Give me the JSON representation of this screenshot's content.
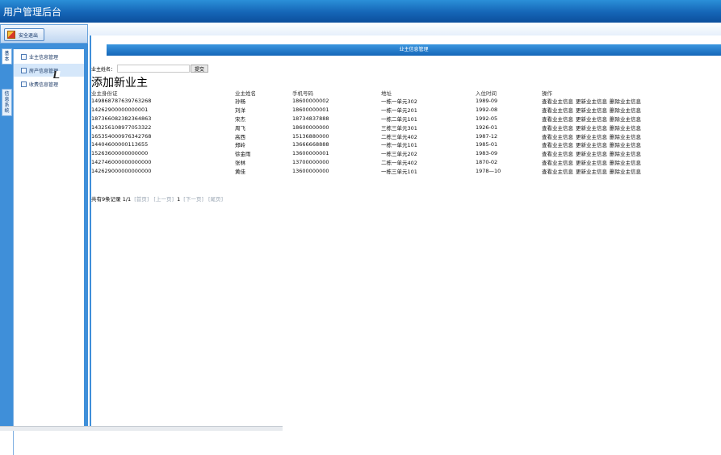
{
  "app": {
    "title": "用户管理后台"
  },
  "sidebar": {
    "exit_label": "安全退出",
    "vtabs": [
      {
        "label": "基本"
      },
      {
        "label": "信息系统"
      }
    ],
    "items": [
      {
        "label": "业主信息管理"
      },
      {
        "label": "房产信息管理"
      },
      {
        "label": "收费信息管理"
      }
    ]
  },
  "main": {
    "banner": "业主信息管理",
    "search_label": "业主姓名：",
    "search_value": "",
    "search_button": "提交",
    "add_title": "添加新业主",
    "columns": [
      "业主身份证",
      "业主姓名",
      "手机号码",
      "地址",
      "入住时间",
      "操作"
    ],
    "rows": [
      [
        "149868787639763268",
        "孙畅",
        "18600000002",
        "一栋一单元302",
        "1989-09"
      ],
      [
        "14262900000000001",
        "刘洋",
        "18600000001",
        "一栋一单元201",
        "1992-08"
      ],
      [
        "187366082382364863",
        "宋杰",
        "18734837888",
        "一栋二单元101",
        "1992-05"
      ],
      [
        "143256108977053322",
        "周飞",
        "18600000000",
        "三栋三单元301",
        "1926-01"
      ],
      [
        "165354000976342768",
        "高西",
        "15136880000",
        "二栋三单元402",
        "1987-12"
      ],
      [
        "14404600000113655",
        "郑岭",
        "13666668888",
        "一栋一单元101",
        "1985-01"
      ],
      [
        "15263600000000000",
        "徐金雨",
        "13600000001",
        "一栋三单元202",
        "1983-09"
      ],
      [
        "142746000000000000",
        "张林",
        "13700000000",
        "二栋一单元402",
        "1870-02"
      ],
      [
        "142629000000000000",
        "黄佳",
        "13600000000",
        "一栋三单元101",
        "1978—10"
      ]
    ],
    "ops": [
      "查看业主信息",
      "更新业主信息",
      "删除业主信息"
    ],
    "pager": {
      "summary": "共有9条记录",
      "page": "1/1",
      "first": "[首页]",
      "prev": "[上一页]",
      "current": "1",
      "next": "[下一页]",
      "last": "[尾页]"
    }
  },
  "colors": {
    "header": "#1565b6",
    "sidebar": "#3f8fd9",
    "banner": "#1566b8"
  }
}
